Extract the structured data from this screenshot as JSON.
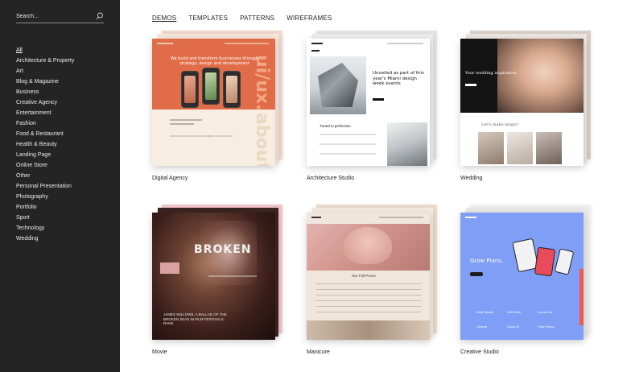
{
  "sidebar": {
    "search_placeholder": "Search...",
    "categories": [
      "All",
      "Architecture & Property",
      "Art",
      "Blog & Magazine",
      "Business",
      "Creative Agency",
      "Entertainment",
      "Fashion",
      "Food & Restaurant",
      "Health & Beauty",
      "Landing Page",
      "Online Store",
      "Other",
      "Personal Presentation",
      "Photography",
      "Portfolio",
      "Sport",
      "Technology",
      "Wedding"
    ],
    "active_index": 0
  },
  "tabs": [
    {
      "label": "DEMOS",
      "active": true
    },
    {
      "label": "TEMPLATES",
      "active": false
    },
    {
      "label": "PATTERNS",
      "active": false
    },
    {
      "label": "WIREFRAMES",
      "active": false
    }
  ],
  "demos": [
    {
      "title": "Digital Agency",
      "headline": "We build and transform businesses through strategy, design and development",
      "vertical_1": "ui/ux.",
      "vertical_2": "about."
    },
    {
      "title": "Architecture Studio",
      "headline": "Unveiled as part of this year's Miami design week events",
      "sub": "Tuned to perfection"
    },
    {
      "title": "Wedding",
      "headline": "Your wedding inspiration",
      "sub": "Let's make magic!"
    },
    {
      "title": "Movie",
      "headline": "BROKEN",
      "body": "JAMES WILLOWS, A BALLAD OF THE BROKEN SEAS IN FILM FESTIVALS RANK"
    },
    {
      "title": "Manicure",
      "sub": "Our Full Prices"
    },
    {
      "title": "Creative Studio",
      "headline": "Grow Plans.",
      "features": [
        "Web Sports",
        "Drill Even",
        "Launch Ar",
        "Unread",
        "Cloud Ai",
        "Fast Forma",
        "New Project",
        "Origin & Co",
        "Shared View"
      ]
    }
  ],
  "colors": {
    "sidebar_bg": "#242424",
    "agency_orange": "#e06d47",
    "creative_blue": "#7f9ff7",
    "accent_red": "#ef5b4f"
  }
}
